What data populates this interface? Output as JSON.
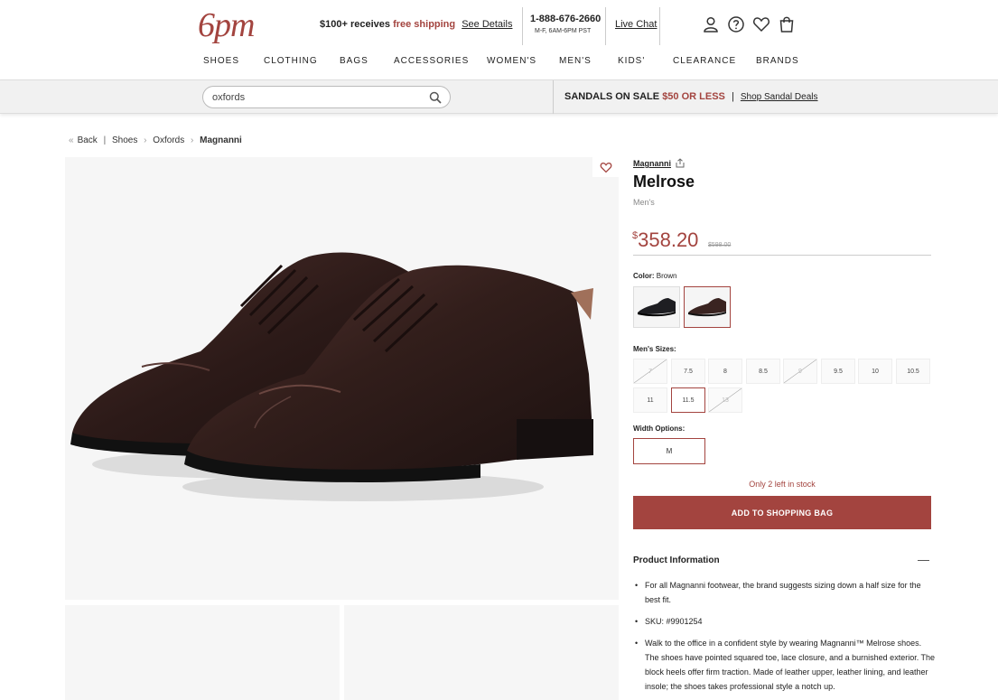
{
  "header": {
    "logo": "6pm",
    "promo": {
      "prefix": "$100+ receives",
      "highlight": "free shipping",
      "link": "See Details"
    },
    "phone": "1-888-676-2660",
    "hours": "M-F, 6AM-6PM PST",
    "chat": "Live Chat",
    "icons": [
      "account-icon",
      "help-icon",
      "favorites-icon",
      "cart-icon"
    ]
  },
  "nav": [
    "SHOES",
    "CLOTHING",
    "BAGS",
    "ACCESSORIES",
    "WOMEN'S",
    "MEN'S",
    "KIDS'",
    "CLEARANCE",
    "BRANDS"
  ],
  "search": {
    "value": "oxfords",
    "placeholder": "Search"
  },
  "sale_banner": {
    "prefix": "SANDALS ON SALE",
    "price": "$50 OR LESS",
    "separator": "|",
    "link": "Shop Sandal Deals"
  },
  "breadcrumb": {
    "back": "Back",
    "items": [
      "Shoes",
      "Oxfords"
    ],
    "current": "Magnanni"
  },
  "product": {
    "brand": "Magnanni",
    "name": "Melrose",
    "gender": "Men's",
    "currency": "$",
    "price": "358.20",
    "original_price": "$598.00",
    "color_label": "Color:",
    "color_value": "Brown",
    "colors": [
      {
        "name": "Black",
        "selected": false,
        "shoe_color": "#1e1e22"
      },
      {
        "name": "Brown",
        "selected": true,
        "shoe_color": "#3a2421"
      }
    ],
    "sizes_label": "Men's Sizes:",
    "sizes": [
      {
        "label": "7",
        "available": false,
        "selected": false
      },
      {
        "label": "7.5",
        "available": true,
        "selected": false
      },
      {
        "label": "8",
        "available": true,
        "selected": false
      },
      {
        "label": "8.5",
        "available": true,
        "selected": false
      },
      {
        "label": "9",
        "available": false,
        "selected": false
      },
      {
        "label": "9.5",
        "available": true,
        "selected": false
      },
      {
        "label": "10",
        "available": true,
        "selected": false
      },
      {
        "label": "10.5",
        "available": true,
        "selected": false
      },
      {
        "label": "11",
        "available": true,
        "selected": false
      },
      {
        "label": "11.5",
        "available": true,
        "selected": true
      },
      {
        "label": "13",
        "available": false,
        "selected": false
      }
    ],
    "width_label": "Width Options:",
    "width": "M",
    "stock": "Only 2 left in stock",
    "add_button": "ADD TO SHOPPING BAG"
  },
  "product_info": {
    "title": "Product Information",
    "bullets": [
      "For all Magnanni footwear, the brand suggests sizing down a half size for the best fit.",
      "SKU: #9901254",
      "Walk to the office in a confident style by wearing Magnanni™ Melrose shoes. The shoes have pointed squared toe, lace closure, and a burnished exterior. The block heels offer firm traction. Made of leather upper, leather lining, and leather insole; the shoes takes professional style a notch up."
    ]
  },
  "colors": {
    "accent": "#a3443f",
    "image_bg": "#f6f6f6",
    "band_bg": "#f1f1f1"
  }
}
